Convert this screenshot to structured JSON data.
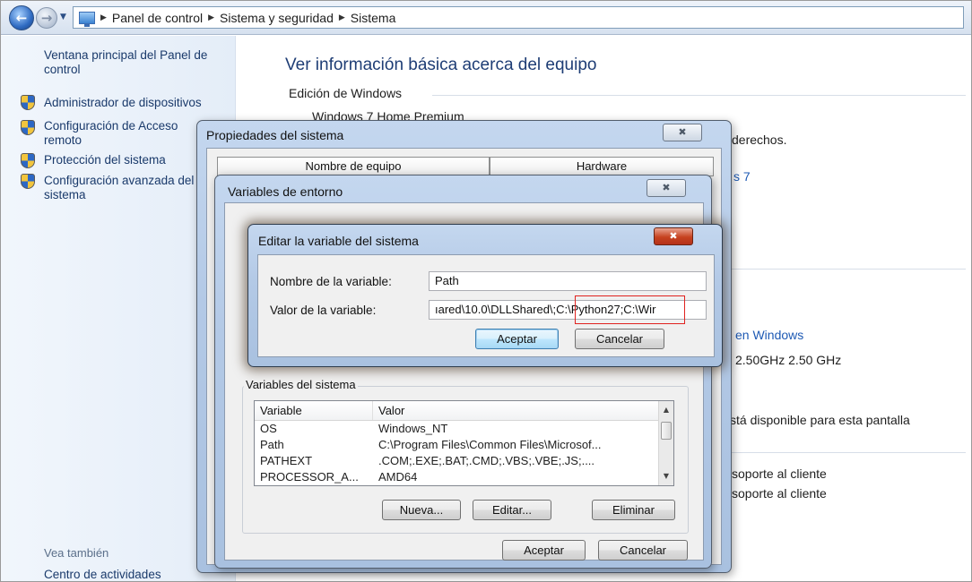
{
  "address_bar": {
    "breadcrumbs": [
      "Panel de control",
      "Sistema y seguridad",
      "Sistema"
    ]
  },
  "left_panel": {
    "home_link": "Ventana principal del Panel de control",
    "tasks": [
      "Administrador de dispositivos",
      "Configuración de Acceso remoto",
      "Protección del sistema",
      "Configuración avanzada del sistema"
    ],
    "see_also_heading": "Vea también",
    "see_also_links": [
      "Centro de actividades"
    ]
  },
  "main": {
    "title": "Ver información básica acerca del equipo",
    "edition_heading": "Edición de Windows",
    "edition_value": "Windows 7 Home Premium",
    "rights_fragment": "derechos.",
    "sp_fragment": "s 7",
    "windows_link_fragment": "en Windows",
    "cpu_fragment": "2.50GHz  2.50 GHz",
    "pen_fragment": "stá disponible para esta pantalla",
    "support_fragment_1": "soporte al cliente",
    "support_fragment_2": "soporte al cliente"
  },
  "dialog_properties": {
    "title": "Propiedades del sistema",
    "tabs": [
      "Nombre de equipo",
      "Hardware"
    ],
    "close_icon": "close-icon"
  },
  "dialog_env": {
    "title": "Variables de entorno",
    "system_group_label": "Variables del sistema",
    "columns": [
      "Variable",
      "Valor"
    ],
    "rows": [
      {
        "variable": "OS",
        "value": "Windows_NT"
      },
      {
        "variable": "Path",
        "value": "C:\\Program Files\\Common Files\\Microsof..."
      },
      {
        "variable": "PATHEXT",
        "value": ".COM;.EXE;.BAT;.CMD;.VBS;.VBE;.JS;...."
      },
      {
        "variable": "PROCESSOR_A...",
        "value": "AMD64"
      }
    ],
    "buttons": {
      "new": "Nueva...",
      "edit": "Editar...",
      "delete": "Eliminar"
    },
    "ok": "Aceptar",
    "cancel": "Cancelar"
  },
  "dialog_edit": {
    "title": "Editar la variable del sistema",
    "name_label": "Nombre de la variable:",
    "name_value": "Path",
    "value_label": "Valor de la variable:",
    "value_text": "ıared\\10.0\\DLLShared\\;C:\\Python27;C:\\Wir",
    "ok": "Aceptar",
    "cancel": "Cancelar"
  },
  "colors": {
    "highlight": "#e0221f",
    "link": "#1e5ab4",
    "title_text": "#1e3d75"
  }
}
